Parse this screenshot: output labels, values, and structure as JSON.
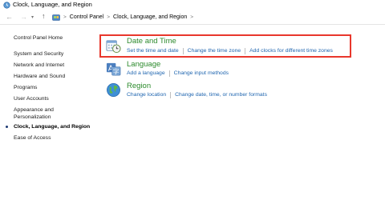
{
  "window": {
    "title": "Clock, Language, and Region"
  },
  "nav": {
    "back_glyph": "←",
    "forward_glyph": "→",
    "dropdown_glyph": "▾",
    "up_glyph": "↑",
    "breadcrumbs": [
      "Control Panel",
      "Clock, Language, and Region"
    ],
    "separator": ">"
  },
  "sidebar": {
    "items": [
      {
        "label": "Control Panel Home"
      },
      {
        "label": "System and Security"
      },
      {
        "label": "Network and Internet"
      },
      {
        "label": "Hardware and Sound"
      },
      {
        "label": "Programs"
      },
      {
        "label": "User Accounts"
      },
      {
        "label": "Appearance and"
      },
      {
        "label": "Personalization"
      },
      {
        "label": "Clock, Language, and Region"
      },
      {
        "label": "Ease of Access"
      }
    ]
  },
  "categories": [
    {
      "title": "Date and Time",
      "icon": "date-time-icon",
      "links": [
        "Set the time and date",
        "Change the time zone",
        "Add clocks for different time zones"
      ]
    },
    {
      "title": "Language",
      "icon": "language-icon",
      "links": [
        "Add a language",
        "Change input methods"
      ]
    },
    {
      "title": "Region",
      "icon": "region-globe-icon",
      "links": [
        "Change location",
        "Change date, time, or number formats"
      ]
    }
  ],
  "colors": {
    "category_title": "#2c8a2c",
    "link": "#2066b0",
    "highlight_border": "#e8372c"
  }
}
